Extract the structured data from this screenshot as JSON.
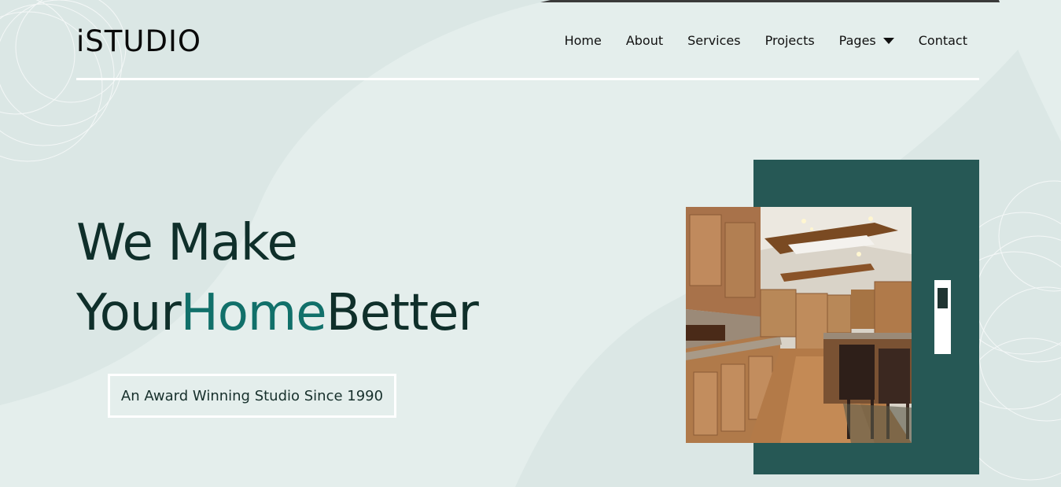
{
  "brand": {
    "logo_text": "iSTUDIO"
  },
  "nav": {
    "items": [
      {
        "label": "Home"
      },
      {
        "label": "About"
      },
      {
        "label": "Services"
      },
      {
        "label": "Projects"
      },
      {
        "label": "Pages",
        "has_dropdown": true
      },
      {
        "label": "Contact"
      }
    ]
  },
  "hero": {
    "line1": "We Make",
    "line2_part1": "Your",
    "line2_accent": "Home",
    "line2_part2": "Better",
    "badge": "An Award Winning Studio Since 1990"
  },
  "colors": {
    "background": "#e4eeec",
    "accent": "#11706a",
    "panel": "#265855",
    "heading": "#0f2f2a"
  },
  "icons": {
    "dropdown": "caret-down-icon",
    "photo": "kitchen-interior-image"
  }
}
